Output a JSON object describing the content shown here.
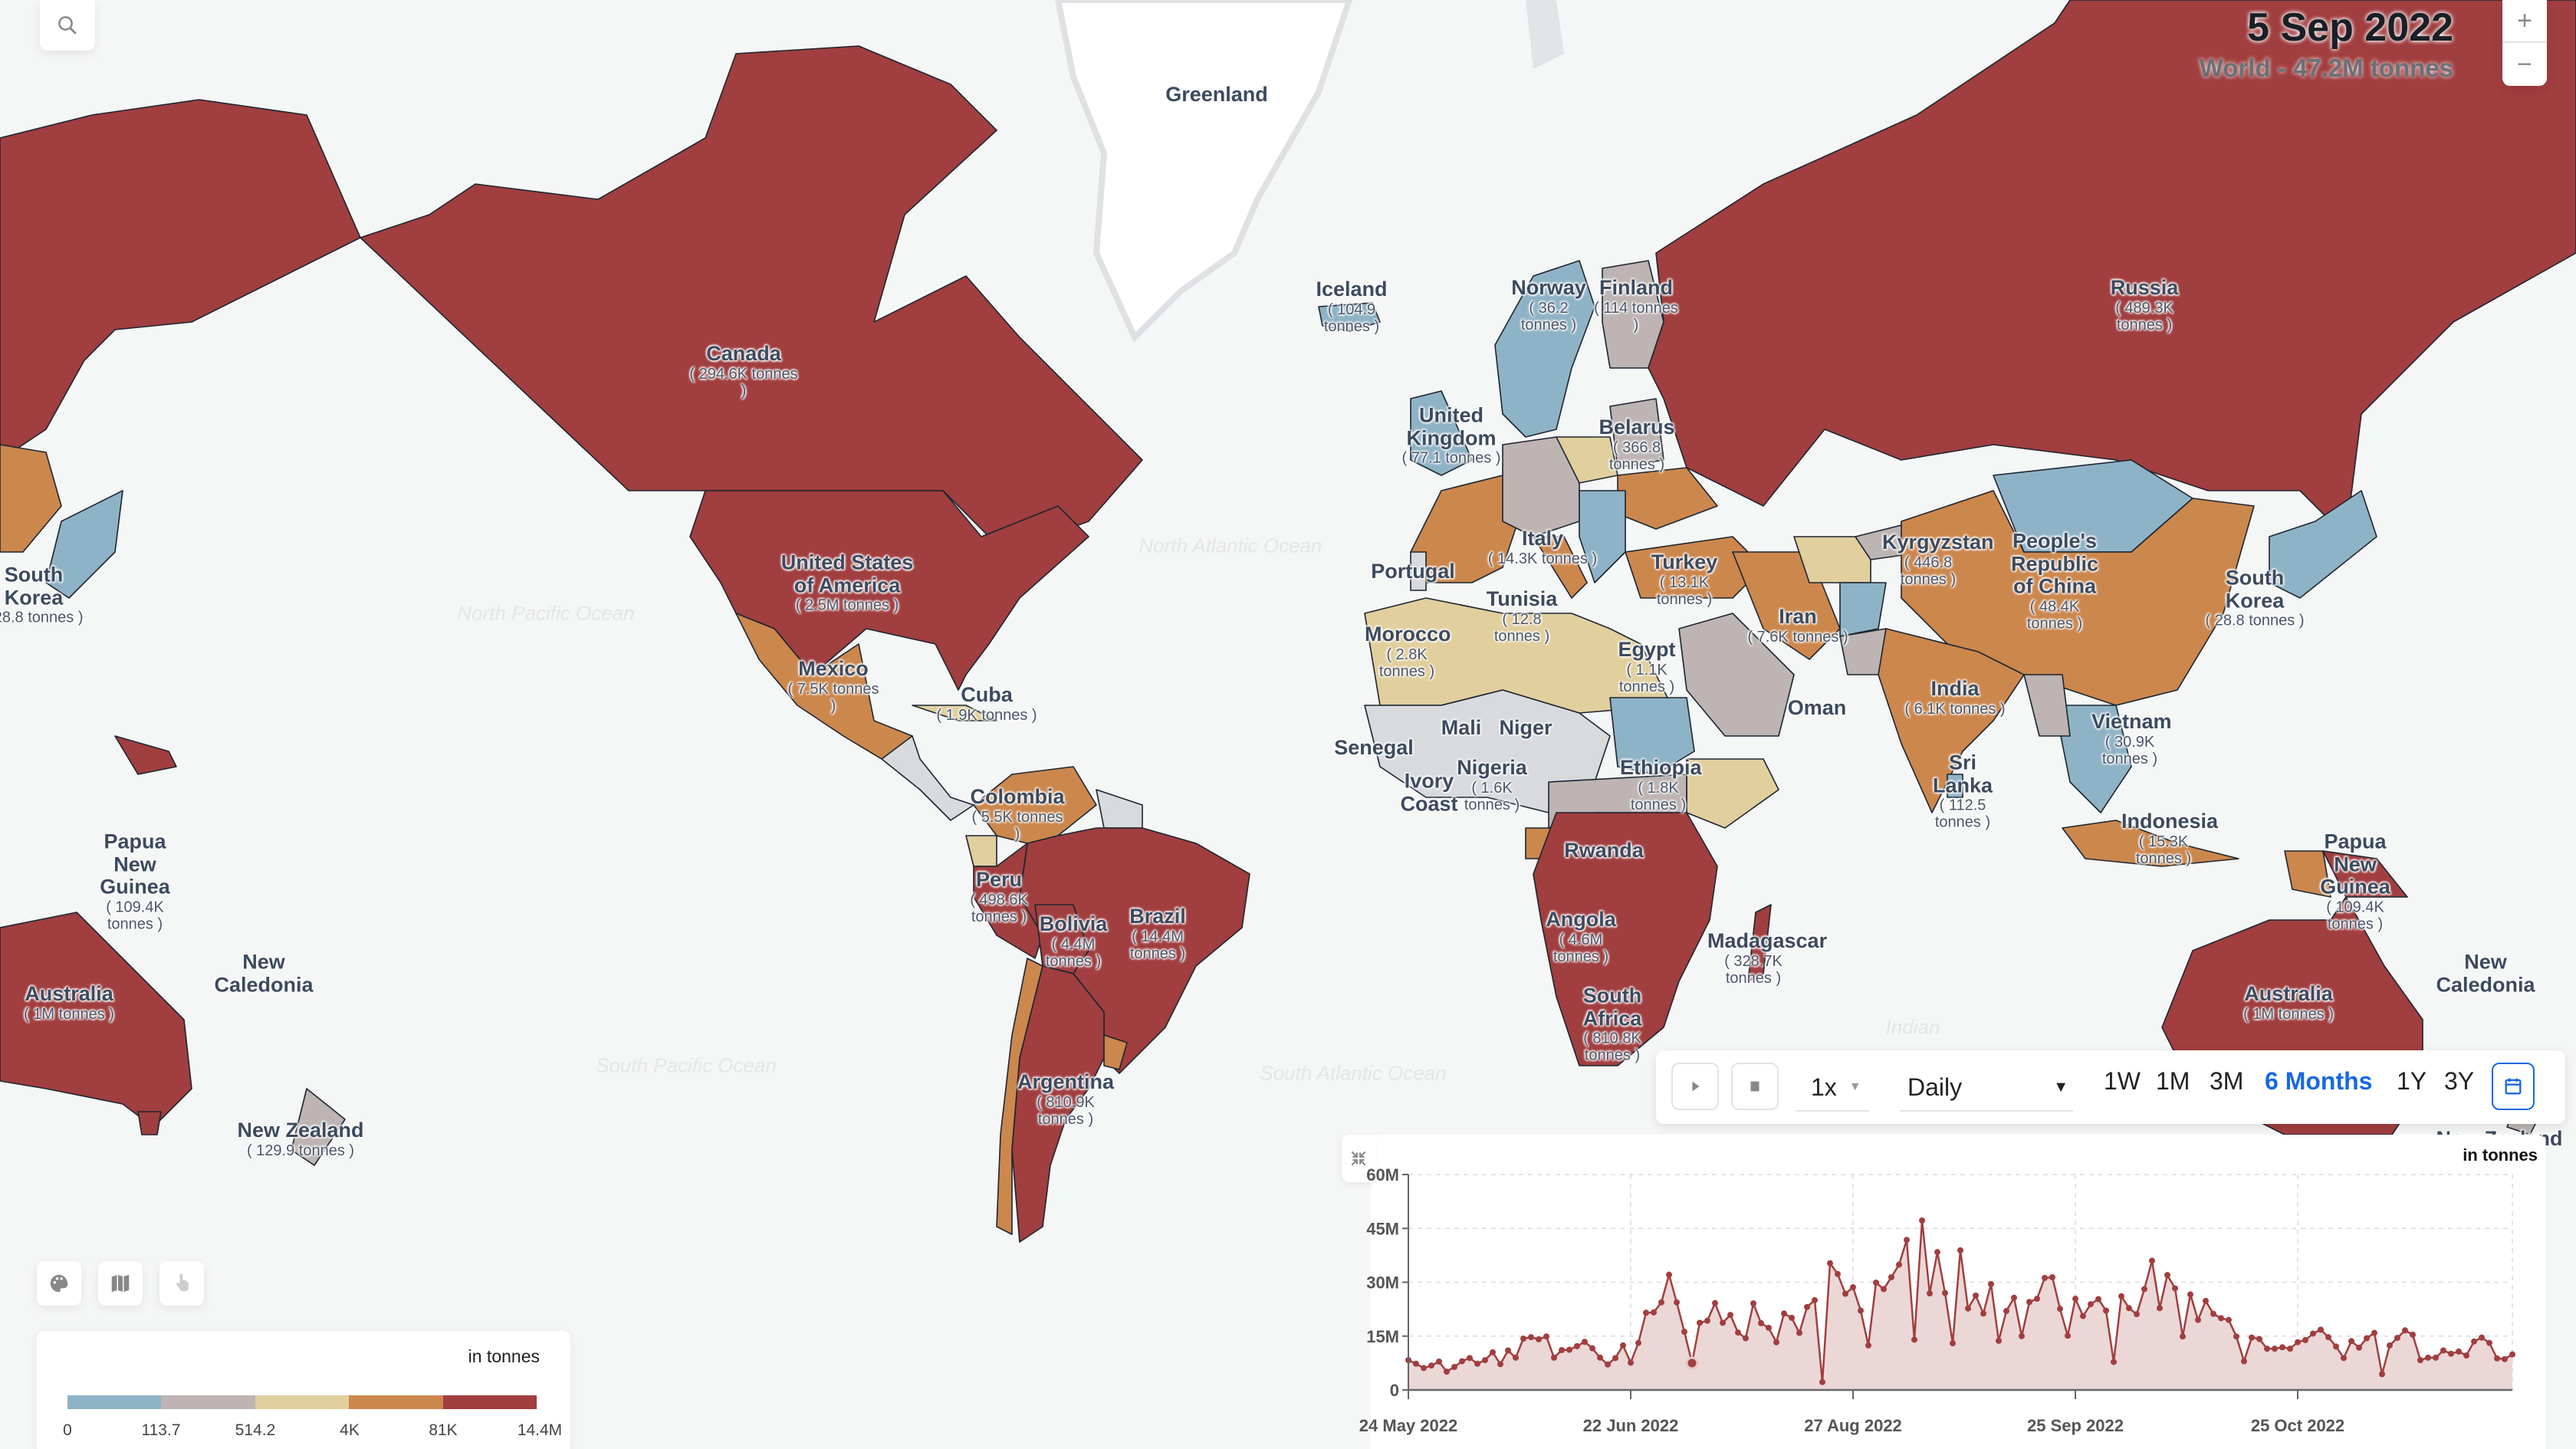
{
  "header": {
    "date": "5 Sep 2022",
    "world_total": "World - 47.2M tonnes"
  },
  "controls": {
    "search_icon": "search-icon",
    "zoom_in": "+",
    "zoom_out": "−",
    "tools": [
      {
        "name": "palette-icon"
      },
      {
        "name": "map-icon"
      },
      {
        "name": "pointer-hand-icon"
      }
    ]
  },
  "legend": {
    "unit": "in tonnes",
    "colors": [
      "#8fb3c6",
      "#bdb4b3",
      "#e1cf9e",
      "#cc874d",
      "#a13e3f"
    ],
    "ticks": [
      "0",
      "113.7",
      "514.2",
      "4K",
      "81K",
      "14.4M"
    ]
  },
  "no_data_color": "#d8dadd",
  "playback": {
    "play_icon": "play-icon",
    "stop_icon": "stop-icon",
    "speed": "1x",
    "interval": "Daily",
    "ranges": [
      {
        "label": "1W",
        "active": false
      },
      {
        "label": "1M",
        "active": false
      },
      {
        "label": "3M",
        "active": false
      },
      {
        "label": "6 Months",
        "active": true
      },
      {
        "label": "1Y",
        "active": false
      },
      {
        "label": "3Y",
        "active": false
      }
    ],
    "calendar_icon": "calendar-icon",
    "accent": "#1769e0"
  },
  "oceans": [
    {
      "label": "North Pacific Ocean"
    },
    {
      "label": "North Atlantic Ocean"
    },
    {
      "label": "South Pacific Ocean"
    },
    {
      "label": "South Atlantic Ocean"
    },
    {
      "label": "Indian"
    }
  ],
  "countries": [
    {
      "name": "Greenland",
      "value": ""
    },
    {
      "name": "Canada",
      "value": "( 294.6K tonnes )"
    },
    {
      "name": "United States of America",
      "value": "( 2.5M tonnes )"
    },
    {
      "name": "Mexico",
      "value": "( 7.5K tonnes )"
    },
    {
      "name": "Cuba",
      "value": "( 1.9K tonnes )"
    },
    {
      "name": "Colombia",
      "value": "( 5.5K tonnes )"
    },
    {
      "name": "Peru",
      "value": "( 498.6K tonnes )"
    },
    {
      "name": "Bolivia",
      "value": "( 4.4M tonnes )"
    },
    {
      "name": "Brazil",
      "value": "( 14.4M tonnes )"
    },
    {
      "name": "Argentina",
      "value": "( 810.9K tonnes )"
    },
    {
      "name": "Iceland",
      "value": "( 104.9 tonnes )"
    },
    {
      "name": "Norway",
      "value": "( 36.2 tonnes )"
    },
    {
      "name": "Finland",
      "value": "( 114 tonnes )"
    },
    {
      "name": "United Kingdom",
      "value": "( 77.1 tonnes )"
    },
    {
      "name": "Belarus",
      "value": "( 366.8 tonnes )"
    },
    {
      "name": "Portugal",
      "value": ""
    },
    {
      "name": "Italy",
      "value": "( 14.3K tonnes )"
    },
    {
      "name": "Turkey",
      "value": "( 13.1K tonnes )"
    },
    {
      "name": "Tunisia",
      "value": "( 12.8 tonnes )"
    },
    {
      "name": "Morocco",
      "value": "( 2.8K tonnes )"
    },
    {
      "name": "Egypt",
      "value": "( 1.1K tonnes )"
    },
    {
      "name": "Mali",
      "value": ""
    },
    {
      "name": "Niger",
      "value": ""
    },
    {
      "name": "Senegal",
      "value": ""
    },
    {
      "name": "Ivory Coast",
      "value": ""
    },
    {
      "name": "Nigeria",
      "value": "( 1.6K tonnes )"
    },
    {
      "name": "Ethiopia",
      "value": "( 1.8K tonnes )"
    },
    {
      "name": "Rwanda",
      "value": ""
    },
    {
      "name": "Angola",
      "value": "( 4.6M tonnes )"
    },
    {
      "name": "South Africa",
      "value": "( 810.8K tonnes )"
    },
    {
      "name": "Madagascar",
      "value": "( 328.7K tonnes )"
    },
    {
      "name": "Russia",
      "value": "( 489.3K tonnes )"
    },
    {
      "name": "Kyrgyzstan",
      "value": "( 446.8 tonnes )"
    },
    {
      "name": "People's Republic of China",
      "value": "( 48.4K tonnes )"
    },
    {
      "name": "Iran",
      "value": "( 7.6K tonnes )"
    },
    {
      "name": "Oman",
      "value": ""
    },
    {
      "name": "India",
      "value": "( 6.1K tonnes )"
    },
    {
      "name": "Sri Lanka",
      "value": "( 112.5 tonnes )"
    },
    {
      "name": "Vietnam",
      "value": "( 30.9K tonnes )"
    },
    {
      "name": "Indonesia",
      "value": "( 15.3K tonnes )"
    },
    {
      "name": "South Korea",
      "value": "( 28.8 tonnes )"
    },
    {
      "name": "Papua New Guinea",
      "value": "( 109.4K tonnes )"
    },
    {
      "name": "Australia",
      "value": "( 1M tonnes )"
    },
    {
      "name": "New Caledonia",
      "value": ""
    },
    {
      "name": "New Zealand",
      "value": "( 129.9 tonnes )"
    }
  ],
  "chart_data": {
    "type": "area",
    "title": "",
    "unit_label": "in tonnes",
    "xlabel": "",
    "ylabel": "",
    "ylim": [
      0,
      60000000
    ],
    "yticks": [
      "0",
      "15M",
      "30M",
      "45M",
      "60M"
    ],
    "ytick_values": [
      0,
      15000000,
      30000000,
      45000000,
      60000000
    ],
    "xtick_labels": [
      "24 May 2022",
      "22 Jun 2022",
      "27 Aug 2022",
      "25 Sep 2022",
      "25 Oct 2022"
    ],
    "xtick_index": [
      0,
      29,
      58,
      87,
      116
    ],
    "grid": true,
    "highlight_index": 37,
    "highlight_label": "5 Sep 2022",
    "series": [
      {
        "name": "World",
        "color": "#a13e3f",
        "fill": "#ecd7d7",
        "values_millions": [
          8.3,
          7.3,
          6.1,
          6.8,
          7.9,
          5.1,
          6.4,
          8.0,
          8.9,
          7.3,
          8.3,
          10.5,
          7.2,
          11.0,
          9.0,
          14.3,
          14.7,
          14.1,
          14.9,
          9.0,
          11.1,
          11.2,
          12.2,
          13.4,
          11.6,
          9.0,
          7.1,
          8.9,
          12.4,
          7.6,
          13.1,
          21.5,
          21.6,
          24.4,
          32.1,
          24.4,
          16.2,
          7.5,
          18.7,
          19.3,
          24.2,
          18.7,
          20.9,
          16.0,
          14.4,
          24.1,
          18.6,
          17.3,
          13.3,
          21.3,
          20.1,
          15.9,
          23.1,
          25.0,
          2.2,
          35.3,
          32.3,
          26.8,
          28.6,
          22.1,
          12.4,
          29.9,
          28.1,
          31.4,
          34.9,
          41.8,
          14.0,
          47.2,
          26.9,
          38.4,
          27.0,
          13.0,
          38.9,
          22.7,
          26.3,
          21.3,
          29.5,
          13.7,
          22.0,
          25.7,
          15.0,
          24.5,
          25.4,
          31.2,
          31.4,
          22.6,
          15.1,
          25.4,
          20.6,
          23.9,
          25.3,
          22.1,
          7.8,
          26.1,
          22.8,
          21.1,
          28.1,
          36.0,
          22.8,
          32.0,
          28.3,
          14.9,
          26.6,
          19.5,
          24.8,
          21.2,
          20.0,
          19.5,
          14.9,
          8.0,
          14.6,
          14.2,
          11.5,
          11.5,
          11.9,
          11.5,
          13.3,
          13.9,
          15.7,
          16.8,
          14.7,
          12.1,
          8.9,
          13.6,
          11.8,
          14.4,
          15.9,
          4.4,
          12.4,
          14.5,
          16.6,
          15.4,
          8.3,
          9.0,
          9.0,
          11.0,
          10.1,
          10.7,
          9.6,
          13.5,
          14.6,
          13.1,
          8.8,
          8.6,
          9.9
        ]
      }
    ]
  }
}
